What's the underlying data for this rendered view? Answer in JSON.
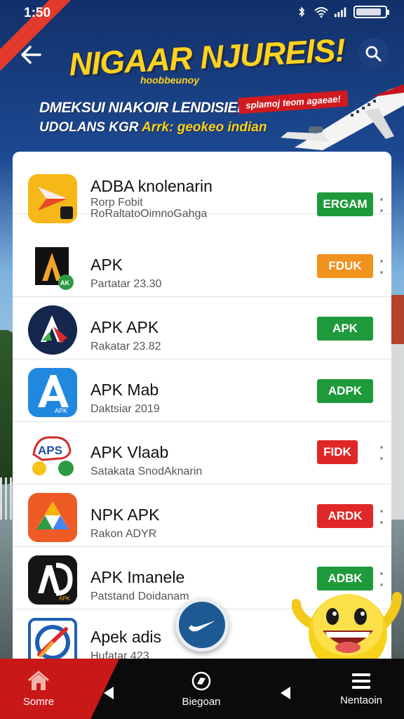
{
  "status_bar": {
    "time": "1:50",
    "icons": [
      "bluetooth-icon",
      "wifi-icon",
      "signal-icon",
      "battery-icon"
    ]
  },
  "header": {
    "back_icon": "arrow-left-icon",
    "search_icon": "search-icon",
    "banner": {
      "title": "NIGAAR NJURElS!",
      "subtitle": "hoobbeunoy",
      "line1": "DMEKSUI NIAKOIR LENDISIEI",
      "line2_a": "UDOLANS KGR",
      "line2_b": "Arrk: geokeo indian",
      "tag": "splamoj teom agaeae!"
    }
  },
  "apps": [
    {
      "name": "ADBA knolenarin",
      "sub": "Rorp Fobit",
      "sub2": "RoRaltatoOimnoGahga",
      "button": "ERGAM",
      "button_color": "#1f9a3b",
      "icon": "play-store-style-icon",
      "menu": true
    },
    {
      "name": "APK",
      "sub": "Partatar 23.30",
      "button": "FDUK",
      "button_color": "#f2921e",
      "icon": "apk-a-logo-icon",
      "menu": true
    },
    {
      "name": "APK APK",
      "sub": "Rakatar 23.82",
      "button": "APK",
      "button_color": "#1f9a3b",
      "icon": "apk-circle-logo-icon",
      "menu": false
    },
    {
      "name": "APK Mab",
      "sub": "Daktsiar 2019",
      "button": "ADPK",
      "button_color": "#1f9a3b",
      "icon": "apk-blue-a-icon",
      "menu": false
    },
    {
      "name": "APK Vlaab",
      "sub": "Satakata SnodAknarin",
      "button": "FIDK",
      "button_color": "#e02727",
      "icon": "apk-sticker-icon",
      "menu": true
    },
    {
      "name": "NPK APK",
      "sub": "Rakon ADYR",
      "button": "ARDK",
      "button_color": "#e02727",
      "icon": "drive-triangle-icon",
      "menu": true
    },
    {
      "name": "APK Imanele",
      "sub": "Patstand Doidanam",
      "button": "ADBK",
      "button_color": "#1f9a3b",
      "icon": "apk-dark-ad-icon",
      "menu": true
    },
    {
      "name": "Apek adis",
      "sub": "Hufatar 423",
      "button": "",
      "button_color": "#1f9a3b",
      "icon": "compass-apk-icon",
      "menu": false
    }
  ],
  "fab_icon": "swoosh-icon",
  "mascot_icon": "smiley-mascot-icon",
  "bottom_nav": {
    "items": [
      {
        "label": "Somre",
        "icon": "home-icon"
      },
      {
        "label": "Biegoan",
        "icon": "compass-icon"
      },
      {
        "label": "Nentaoin",
        "icon": "menu-icon"
      }
    ]
  }
}
